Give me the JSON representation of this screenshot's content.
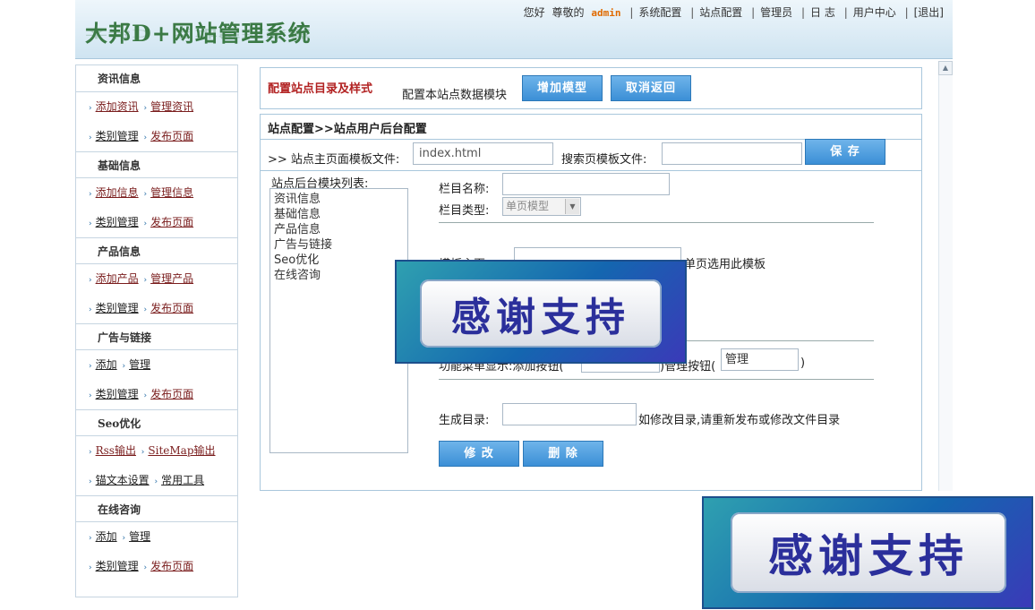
{
  "header": {
    "logo_text": "大邦D+网站管理系统",
    "greeting": "您好",
    "respected": "尊敬的",
    "username": "admin",
    "nav": [
      "系统配置",
      "站点配置",
      "管理员",
      "日 志",
      "用户中心",
      "[退出]"
    ]
  },
  "sidebar": {
    "sections": [
      {
        "title": "资讯信息",
        "rows": [
          [
            "添加资讯",
            "管理资讯"
          ],
          [
            "类别管理",
            "发布页面"
          ]
        ]
      },
      {
        "title": "基础信息",
        "rows": [
          [
            "添加信息",
            "管理信息"
          ],
          [
            "类别管理",
            "发布页面"
          ]
        ]
      },
      {
        "title": "产品信息",
        "rows": [
          [
            "添加产品",
            "管理产品"
          ],
          [
            "类别管理",
            "发布页面"
          ]
        ]
      },
      {
        "title": "广告与链接",
        "rows": [
          [
            "添加",
            "管理"
          ],
          [
            "类别管理",
            "发布页面"
          ]
        ]
      },
      {
        "title": "Seo优化",
        "rows": [
          [
            "Rss输出",
            "SiteMap输出"
          ],
          [
            "锚文本设置",
            "常用工具"
          ]
        ]
      },
      {
        "title": "在线咨询",
        "rows": [
          [
            "添加",
            "管理"
          ],
          [
            "类别管理",
            "发布页面"
          ]
        ]
      }
    ]
  },
  "box1": {
    "title": "配置站点目录及样式",
    "desc": "配置本站点数据模块",
    "add_model_label": "增加模型",
    "cancel_label": "取消返回"
  },
  "box2": {
    "title": "站点配置>>站点用户后台配置",
    "main_tpl_label": ">> 站点主页面模板文件:",
    "main_tpl_value": "index.html",
    "search_tpl_label": "搜索页模板文件:",
    "save_label": "保 存",
    "module_list_label": "站点后台模块列表:",
    "modules": [
      "资讯信息",
      "基础信息",
      "产品信息",
      "广告与链接",
      "Seo优化",
      "在线咨询"
    ],
    "col_name_label": "栏目名称:",
    "col_type_label": "栏目类型:",
    "col_type_value": "单页模型",
    "tpl_home_label": "模板主页",
    "single_tpl_label": "单页选用此模板",
    "func_label": "功能菜单显示:添加按钮(",
    "manage_btn_label": ")管理按钮(",
    "manage_btn_value": "管理",
    "paren_close": ")",
    "gen_dir_label": "生成目录:",
    "gen_dir_note": "如修改目录,请重新发布或修改文件目录",
    "edit_label": "修 改",
    "delete_label": "删 除"
  },
  "overlay": {
    "thanks_text": "感谢支持"
  }
}
